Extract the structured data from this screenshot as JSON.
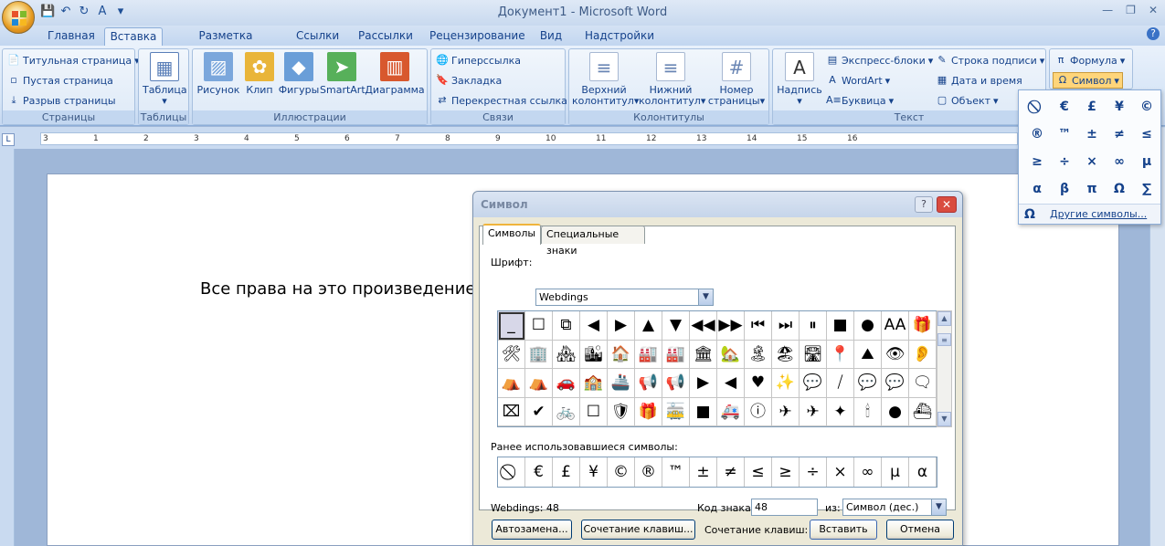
{
  "window": {
    "title": "Документ1 - Microsoft Word"
  },
  "quick_access": [
    {
      "icon": "save-icon",
      "glyph": "💾"
    },
    {
      "icon": "undo-icon",
      "glyph": "↶"
    },
    {
      "icon": "redo-icon",
      "glyph": "↻"
    },
    {
      "icon": "spelling-icon",
      "glyph": "A"
    },
    {
      "icon": "customize-icon",
      "glyph": "▾"
    }
  ],
  "window_controls": {
    "minimize": "—",
    "restore": "❐",
    "close": "✕"
  },
  "tabs": [
    "Главная",
    "Вставка",
    "Разметка страницы",
    "Ссылки",
    "Рассылки",
    "Рецензирование",
    "Вид",
    "Надстройки"
  ],
  "active_tab": "Вставка",
  "ribbon": {
    "pages": {
      "label": "Страницы",
      "title_page": "Титульная страница",
      "blank_page": "Пустая страница",
      "page_break": "Разрыв страницы"
    },
    "tables": {
      "label": "Таблицы",
      "table": "Таблица"
    },
    "illustrations": {
      "label": "Иллюстрации",
      "picture": "Рисунок",
      "clip": "Клип",
      "shapes": "Фигуры",
      "smartart": "SmartArt",
      "chart": "Диаграмма"
    },
    "links": {
      "label": "Связи",
      "hyperlink": "Гиперссылка",
      "bookmark": "Закладка",
      "crossref": "Перекрестная ссылка"
    },
    "headers": {
      "label": "Колонтитулы",
      "header_l1": "Верхний",
      "header_l2": "колонтитул",
      "footer_l1": "Нижний",
      "footer_l2": "колонтитул",
      "pagenum_l1": "Номер",
      "pagenum_l2": "страницы"
    },
    "text": {
      "label": "Текст",
      "textbox": "Надпись",
      "quickparts": "Экспресс-блоки",
      "wordart": "WordArt",
      "dropcap": "Буквица",
      "signature": "Строка подписи",
      "datetime": "Дата и время",
      "object": "Объект"
    },
    "symbols": {
      "equation": "Формула",
      "symbol": "Символ"
    }
  },
  "ruler": {
    "marks": [
      "3",
      "1",
      "2",
      "3",
      "4",
      "5",
      "6",
      "7",
      "8",
      "9",
      "10",
      "11",
      "12",
      "13",
      "14",
      "15",
      "16"
    ]
  },
  "document": {
    "text": "Все права на это произведение п"
  },
  "symbol_panel": {
    "symbols": [
      "⃠",
      "€",
      "£",
      "¥",
      "©",
      "®",
      "™",
      "±",
      "≠",
      "≤",
      "≥",
      "÷",
      "×",
      "∞",
      "µ",
      "α",
      "β",
      "π",
      "Ω",
      "∑"
    ],
    "more_label": "Другие символы...",
    "more_icon": "Ω"
  },
  "dialog": {
    "title": "Символ",
    "help": "?",
    "close": "✕",
    "tab_symbols": "Символы",
    "tab_special": "Специальные знаки",
    "font_label": "Шрифт:",
    "font_value": "Webdings",
    "grid_symbols": [
      [
        "_",
        "☐",
        "⧉",
        "◀",
        "▶",
        "▲",
        "▼",
        "◀◀",
        "▶▶",
        "⏮",
        "⏭",
        "⏸",
        "■",
        "●",
        "AA",
        "🎁"
      ],
      [
        "🛠",
        "🏢",
        "🏘",
        "🏙",
        "🏠",
        "🏭",
        "🏭",
        "🏛",
        "🏡",
        "🏝",
        "🏖",
        "🛣",
        "📍",
        "⛰",
        "👁",
        "👂"
      ],
      [
        "⛺",
        "⛺",
        "🚗",
        "🏫",
        "🚢",
        "📢",
        "📢",
        "▶",
        "◀",
        "♥",
        "✨",
        "💬",
        "⧸",
        "💬",
        "💬",
        "🗨"
      ],
      [
        "⌧",
        "✔",
        "🚲",
        "☐",
        "🛡",
        "🎁",
        "🚋",
        "■",
        "🚑",
        "ⓘ",
        "✈",
        "✈",
        "✦",
        "🕯",
        "●",
        "⛴"
      ]
    ],
    "recent_label": "Ранее использовавшиеся символы:",
    "recent": [
      "⃠",
      "€",
      "£",
      "¥",
      "©",
      "®",
      "™",
      "±",
      "≠",
      "≤",
      "≥",
      "÷",
      "×",
      "∞",
      "µ",
      "α"
    ],
    "charinfo": "Webdings: 48",
    "code_label": "Код знака:",
    "code_value": "48",
    "from_label": "из:",
    "from_value": "Символ (дес.)",
    "autocorrect": "Автозамена...",
    "shortcut_btn": "Сочетание клавиш...",
    "shortcut_label": "Сочетание клавиш:",
    "insert": "Вставить",
    "cancel": "Отмена"
  }
}
